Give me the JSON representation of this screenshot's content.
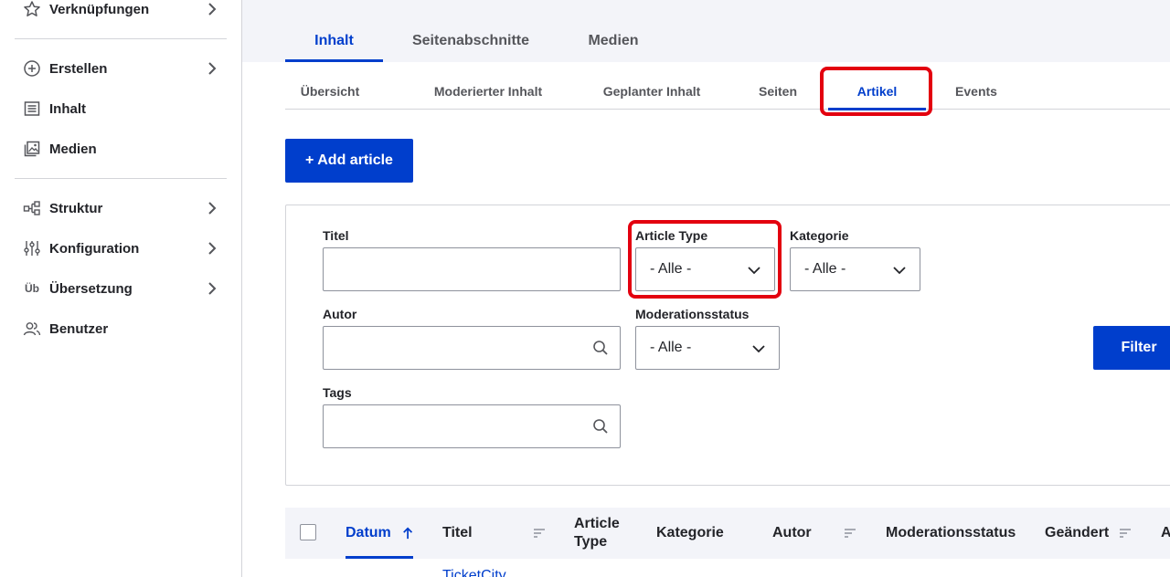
{
  "sidebar": {
    "items": [
      {
        "label": "Verknüpfungen",
        "icon": "star-icon",
        "has_children": true
      },
      {
        "label": "Erstellen",
        "icon": "plus-circle-icon",
        "has_children": true
      },
      {
        "label": "Inhalt",
        "icon": "document-list-icon",
        "has_children": false
      },
      {
        "label": "Medien",
        "icon": "image-icon",
        "has_children": false
      },
      {
        "label": "Struktur",
        "icon": "structure-icon",
        "has_children": true
      },
      {
        "label": "Konfiguration",
        "icon": "sliders-icon",
        "has_children": true
      },
      {
        "label": "Übersetzung",
        "icon": "translation-icon",
        "icon_text": "Üb",
        "has_children": true
      },
      {
        "label": "Benutzer",
        "icon": "users-icon",
        "has_children": false
      }
    ]
  },
  "primary_tabs": [
    {
      "label": "Inhalt",
      "active": true
    },
    {
      "label": "Seitenabschnitte",
      "active": false
    },
    {
      "label": "Medien",
      "active": false
    }
  ],
  "secondary_tabs": [
    {
      "label": "Übersicht",
      "active": false
    },
    {
      "label": "Moderierter Inhalt",
      "active": false
    },
    {
      "label": "Geplanter Inhalt",
      "active": false
    },
    {
      "label": "Seiten",
      "active": false
    },
    {
      "label": "Artikel",
      "active": true
    },
    {
      "label": "Events",
      "active": false
    }
  ],
  "add_button": {
    "label": "+ Add article"
  },
  "filters": {
    "title": {
      "label": "Titel",
      "value": ""
    },
    "article_type": {
      "label": "Article Type",
      "value": "- Alle -"
    },
    "category": {
      "label": "Kategorie",
      "value": "- Alle -"
    },
    "author": {
      "label": "Autor",
      "value": ""
    },
    "moderation": {
      "label": "Moderationsstatus",
      "value": "- Alle -"
    },
    "tags": {
      "label": "Tags",
      "value": ""
    },
    "submit_label": "Filter"
  },
  "table": {
    "columns": [
      {
        "label": "Datum",
        "sorted": "asc"
      },
      {
        "label": "Titel",
        "sortable": true
      },
      {
        "label": "Article Type"
      },
      {
        "label": "Kategorie"
      },
      {
        "label": "Autor",
        "sortable": true
      },
      {
        "label": "Moderationsstatus"
      },
      {
        "label": "Geändert",
        "sortable": true
      },
      {
        "label": "A"
      }
    ],
    "first_row_title": "TicketCity"
  },
  "colors": {
    "accent": "#003ecc",
    "highlight": "#e3000f",
    "text": "#232429",
    "border": "#d3d4d9"
  }
}
